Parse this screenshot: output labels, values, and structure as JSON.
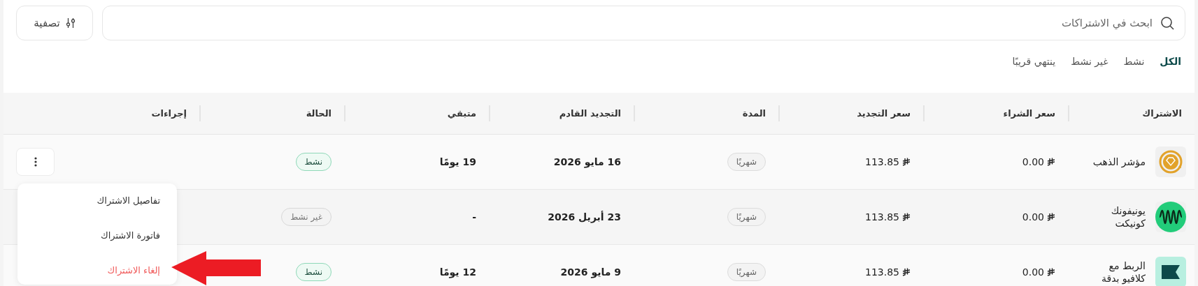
{
  "search": {
    "placeholder": "ابحث في الاشتراكات"
  },
  "filter_button": {
    "label": "تصفية"
  },
  "tabs": [
    {
      "label": "الكل",
      "selected": true
    },
    {
      "label": "نشط",
      "selected": false
    },
    {
      "label": "غير نشط",
      "selected": false
    },
    {
      "label": "ينتهي قريبًا",
      "selected": false
    }
  ],
  "table": {
    "columns": [
      "الاشتراك",
      "سعر الشراء",
      "سعر التجديد",
      "المدة",
      "التجديد القادم",
      "متبقي",
      "الحالة",
      "إجراءات"
    ],
    "rows": [
      {
        "kind": "gold",
        "name": "مؤشر الذهب",
        "purchase_price": "0.00",
        "renewal_price": "113.85",
        "duration": "شهريًا",
        "next_renewal": "16 مايو 2026",
        "remaining": "19 يومًا",
        "status": {
          "label": "نشط",
          "active": true
        }
      },
      {
        "kind": "wave",
        "name": "يونيفونك كونيكت",
        "purchase_price": "0.00",
        "renewal_price": "113.85",
        "duration": "شهريًا",
        "next_renewal": "23 أبريل 2026",
        "remaining": "-",
        "status": {
          "label": "غير نشط",
          "active": false
        }
      },
      {
        "kind": "flag",
        "name": "الربط مع كلافيو بدقة",
        "purchase_price": "0.00",
        "renewal_price": "113.85",
        "duration": "شهريًا",
        "next_renewal": "9 مايو 2026",
        "remaining": "12 يومًا",
        "status": {
          "label": "نشط",
          "active": true
        }
      }
    ]
  },
  "actions_menu": {
    "items": [
      {
        "label": "تفاصيل الاشتراك",
        "kind": "normal"
      },
      {
        "label": "فاتورة الاشتراك",
        "kind": "normal"
      },
      {
        "label": "إلغاء الاشتراك",
        "kind": "danger"
      }
    ]
  }
}
